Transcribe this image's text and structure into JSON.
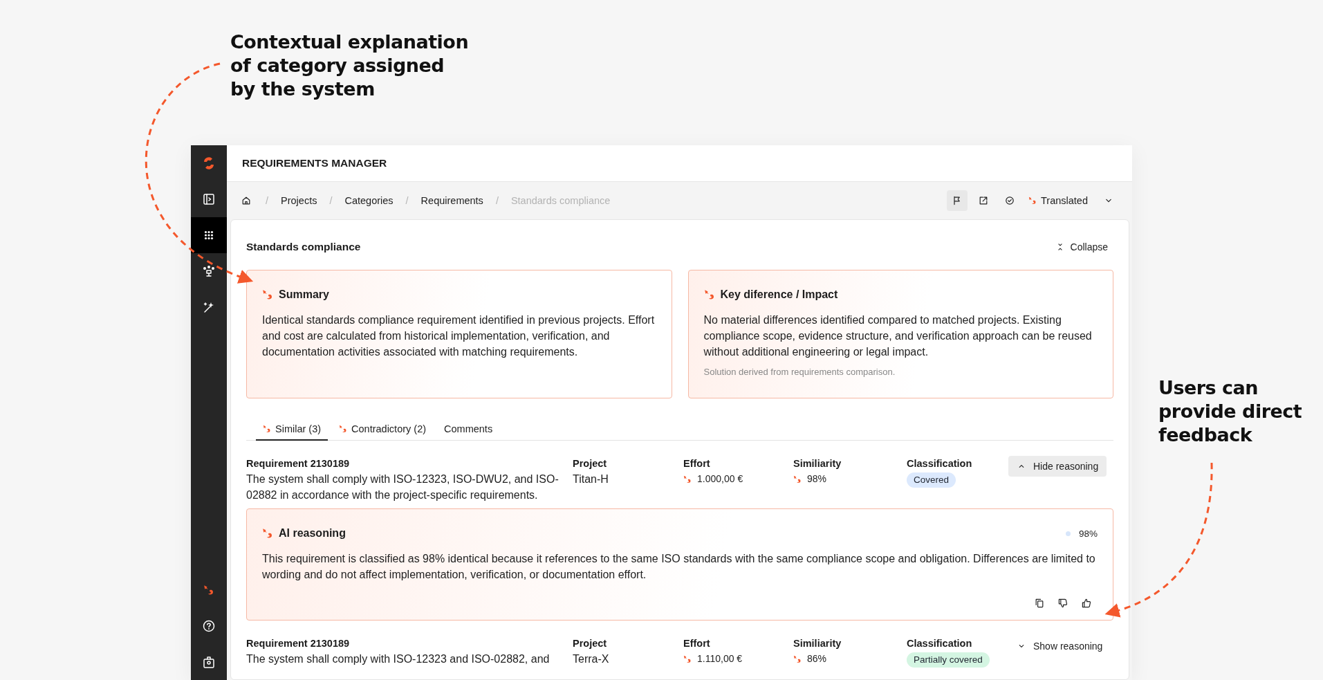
{
  "annotations": [
    {
      "kind": "left",
      "text": "Contextual explanation\nof category assigned\nby the system"
    },
    {
      "kind": "right",
      "text": "Users can\nprovide direct\nfeedback"
    }
  ],
  "sidebar": {
    "items": [
      {
        "kind": "panel",
        "selected": false
      },
      {
        "kind": "grid",
        "selected": true
      },
      {
        "kind": "org",
        "selected": false
      },
      {
        "kind": "wand",
        "selected": false
      }
    ],
    "bottom": [
      {
        "kind": "ai"
      },
      {
        "kind": "help"
      },
      {
        "kind": "badge"
      }
    ]
  },
  "header": {
    "title": "REQUIREMENTS MANAGER"
  },
  "breadcrumbs": {
    "separator": "/",
    "items": [
      {
        "label": "Projects",
        "current": false
      },
      {
        "label": "Categories",
        "current": false
      },
      {
        "label": "Requirements",
        "current": false
      },
      {
        "label": "Standards compliance",
        "current": true
      }
    ]
  },
  "toolbar": {
    "buttons": [
      {
        "kind": "flag",
        "active": true
      },
      {
        "kind": "external",
        "active": false
      },
      {
        "kind": "check",
        "active": false
      }
    ],
    "translation": "Translated"
  },
  "section": {
    "title": "Standards compliance",
    "collapse": "Collapse"
  },
  "cards": [
    {
      "title": "Summary",
      "text": "Identical standards compliance requirement identified in previous projects. Effort and cost are calculated from historical implementation, verification, and documentation activities associated with matching requirements."
    },
    {
      "title": "Key diference / Impact",
      "text": "No material differences identified compared to matched projects. Existing compliance scope, evidence structure, and verification approach can be reused without additional engineering or legal impact.",
      "note": "Solution derived from requirements comparison."
    }
  ],
  "tabs": [
    {
      "label": "Similar (3)",
      "ai": true,
      "selected": true
    },
    {
      "label": "Contradictory (2)",
      "ai": true,
      "selected": false
    },
    {
      "label": "Comments",
      "ai": false,
      "selected": false
    }
  ],
  "requirements": [
    {
      "title": "Requirement 2130189",
      "text": "The system shall comply with ISO-12323, ISO-DWU2, and ISO-02882 in accordance with the project-specific requirements.",
      "fields": [
        {
          "kind": "text",
          "label": "Project",
          "value": "Titan-H"
        },
        {
          "kind": "ai",
          "label": "Effort",
          "value": "1.000,00 €"
        },
        {
          "kind": "ai",
          "label": "Similiarity",
          "value": "98%"
        },
        {
          "kind": "badge",
          "label": "Classification",
          "value": "Covered",
          "color": "#dce9fd"
        }
      ],
      "toggle": {
        "label": "Hide reasoning",
        "expanded": true
      },
      "reasoning": {
        "title": "AI reasoning",
        "confidence": "98%",
        "text": "This requirement is classified as 98% identical because it references to the same ISO standards with the same compliance scope and obligation. Differences are limited to wording and do not affect implementation, verification, or documentation effort."
      }
    },
    {
      "title": "Requirement 2130189",
      "text": "The system shall comply with ISO-12323 and ISO-02882, and",
      "fields": [
        {
          "kind": "text",
          "label": "Project",
          "value": "Terra-X"
        },
        {
          "kind": "ai",
          "label": "Effort",
          "value": "1.110,00 €"
        },
        {
          "kind": "ai",
          "label": "Similiarity",
          "value": "86%"
        },
        {
          "kind": "badge",
          "label": "Classification",
          "value": "Partially covered",
          "color": "#d4f5e2"
        }
      ],
      "toggle": {
        "label": "Show reasoning",
        "expanded": false
      }
    }
  ]
}
